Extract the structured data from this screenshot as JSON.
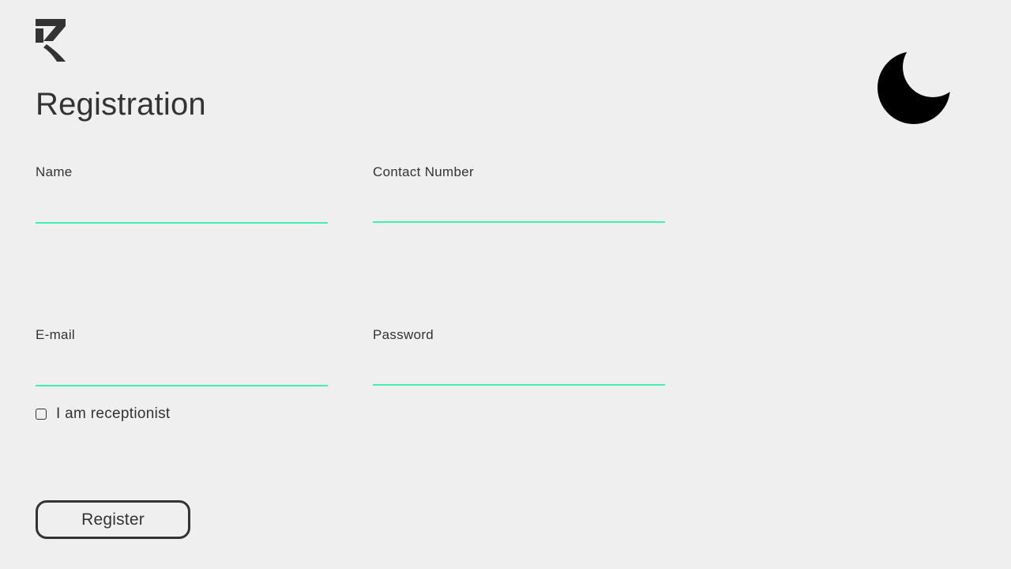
{
  "page": {
    "title": "Registration",
    "background": "#efefef",
    "accent_color": "#3ff0b0",
    "text_color": "#333333"
  },
  "header": {
    "logo_icon": "brand-logo-icon",
    "theme_toggle_icon": "moon-icon"
  },
  "form": {
    "fields": [
      {
        "label": "Name",
        "value": "",
        "placeholder": ""
      },
      {
        "label": "Contact Number",
        "value": "",
        "placeholder": ""
      },
      {
        "label": "E-mail",
        "value": "",
        "placeholder": ""
      },
      {
        "label": "Password",
        "value": "",
        "placeholder": ""
      }
    ],
    "checkbox": {
      "label": "I am receptionist",
      "checked": false
    },
    "submit_label": "Register"
  }
}
